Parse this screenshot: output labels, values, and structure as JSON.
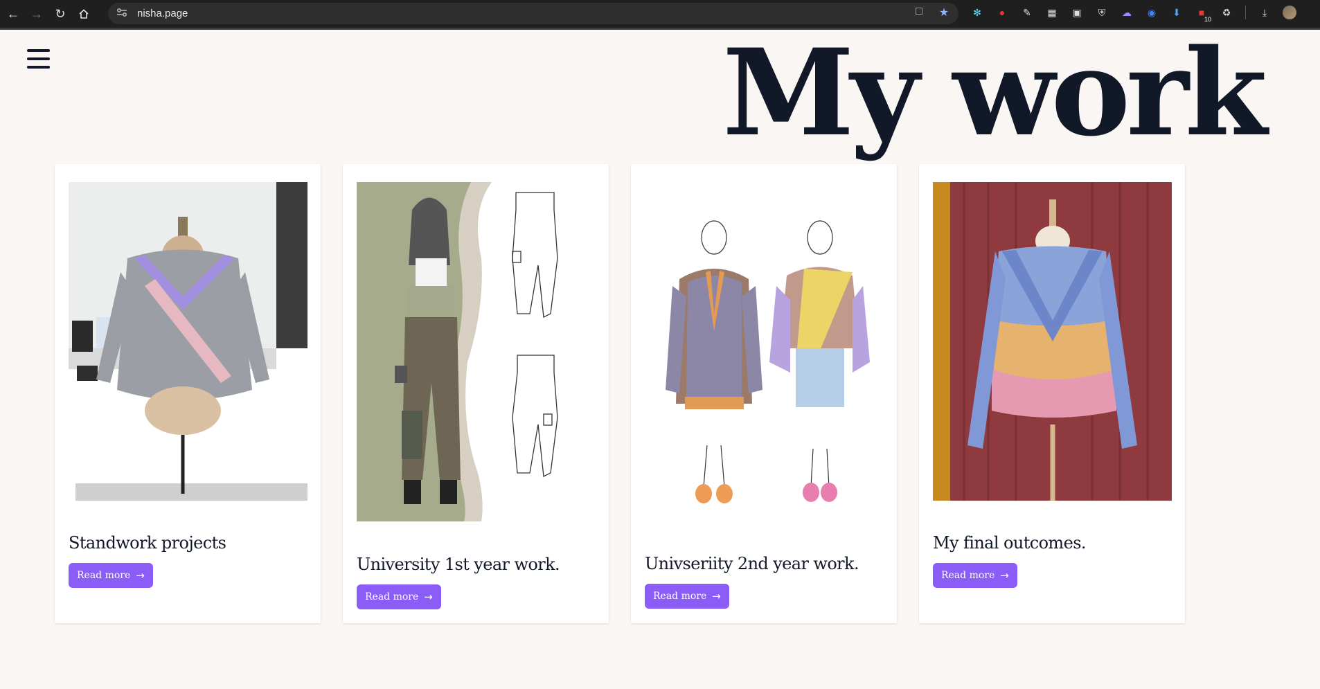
{
  "browser": {
    "url": "nisha.page",
    "extension_badge_count": "10"
  },
  "page": {
    "title": "My work"
  },
  "cards": [
    {
      "title": "Standwork projects",
      "button_label": "Read more"
    },
    {
      "title": "University 1st year work.",
      "button_label": "Read more"
    },
    {
      "title": "Univseriity 2nd year work.",
      "button_label": "Read more"
    },
    {
      "title": "My final outcomes.",
      "button_label": "Read more"
    }
  ],
  "colors": {
    "background": "#faf6f3",
    "accent": "#8b5cf6",
    "heading": "#111827"
  }
}
